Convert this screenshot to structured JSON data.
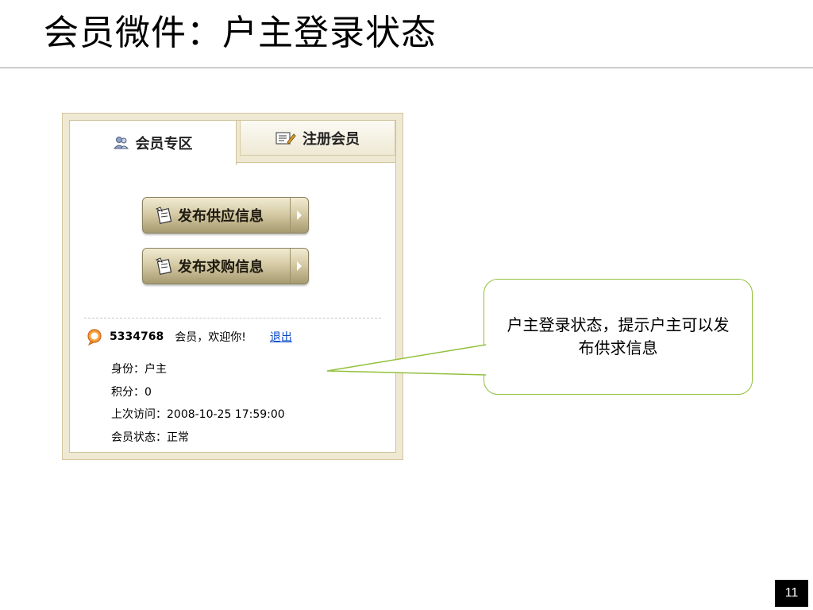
{
  "slide": {
    "title": "会员微件：户主登录状态",
    "page_number": "11"
  },
  "widget": {
    "tabs": [
      {
        "label": "会员专区",
        "icon": "members-icon",
        "active": true
      },
      {
        "label": "注册会员",
        "icon": "register-icon",
        "active": false
      }
    ],
    "buttons": [
      {
        "label": "发布供应信息",
        "icon": "post-icon"
      },
      {
        "label": "发布求购信息",
        "icon": "post-icon"
      }
    ],
    "user": {
      "icon": "qq-status-icon",
      "id": "5334768",
      "welcome": "会员，欢迎你!",
      "logout": "退出"
    },
    "info": [
      "身份：户主",
      "积分：0",
      "上次访问：2008-10-25 17:59:00",
      "会员状态：正常"
    ]
  },
  "callout": {
    "text": "户主登录状态，提示户主可以发布供求信息",
    "border_color": "#92c13c"
  }
}
